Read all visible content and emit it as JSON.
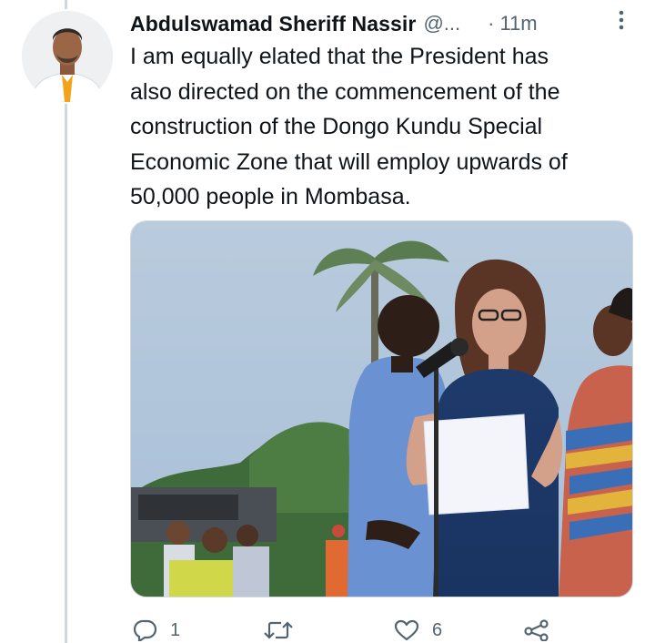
{
  "tweet": {
    "author_name": "Abdulswamad Sheriff Nassir",
    "handle": "@...",
    "separator": "·",
    "time": "11m",
    "text": "I am equally elated that the President has\nalso directed on the commencement of the\nconstruction of the Dongo Kundu Special\nEconomic Zone that will employ upwards of\n50,000 people in Mombasa."
  },
  "actions": {
    "reply": {
      "icon": "reply-icon",
      "count": "1"
    },
    "retweet": {
      "icon": "retweet-icon",
      "count": ""
    },
    "like": {
      "icon": "heart-icon",
      "count": "6"
    },
    "share": {
      "icon": "share-icon"
    }
  },
  "colors": {
    "text": "#0f1419",
    "muted": "#536471",
    "line": "#cfd9de"
  }
}
